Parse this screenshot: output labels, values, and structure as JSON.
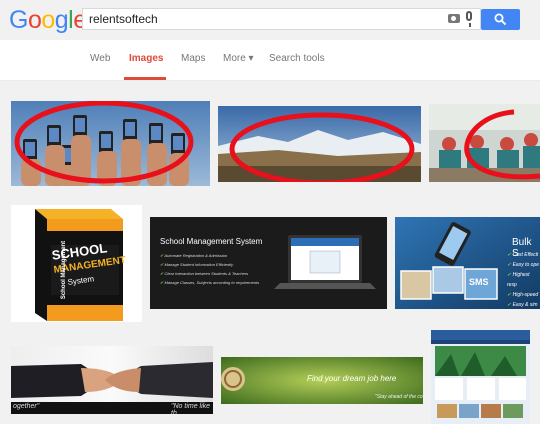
{
  "logo": {
    "letters": [
      "G",
      "o",
      "o",
      "g",
      "l",
      "e"
    ],
    "colors": [
      "#4285f4",
      "#ea4335",
      "#fbbc05",
      "#4285f4",
      "#34a853",
      "#ea4335"
    ]
  },
  "search": {
    "query": "relentsoftech"
  },
  "tabs": {
    "web": "Web",
    "images": "Images",
    "maps": "Maps",
    "more": "More ▾",
    "tools": "Search tools"
  },
  "results": {
    "school_box": {
      "line1": "SCHOOL",
      "line2": "MANAGEMENT",
      "line3": "System",
      "spine": "School Management"
    },
    "sms_banner": {
      "title": "School Management System",
      "bullets": [
        "Automate Registration & Admission",
        "Manage Student Information Efficiently",
        "Clear Interaction between Students & Teachers",
        "Manage Classes, Subjects according to requirements"
      ]
    },
    "bulk_sms": {
      "title": "Bulk S",
      "bullets": [
        "Cost Effecti",
        "Easy to ope",
        "Highest resp",
        "High-speed",
        "Easy & sim"
      ],
      "badge": "SMS"
    },
    "handshake": {
      "left": "ogether\"",
      "right": "\"No time like th"
    },
    "dream_job": {
      "headline": "Find your dream job here",
      "tagline": "\"Stay ahead of the co"
    }
  },
  "colors": {
    "accent": "#dd4b39",
    "search_btn": "#4285f4",
    "annotation_red": "#e8101a"
  }
}
